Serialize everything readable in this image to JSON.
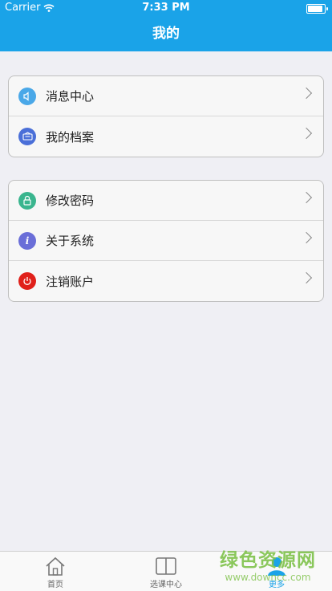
{
  "status_bar": {
    "carrier": "Carrier",
    "time": "7:33 PM"
  },
  "nav": {
    "title": "我的"
  },
  "groups": [
    {
      "items": [
        {
          "label": "消息中心",
          "icon": "speaker-icon",
          "color": "#4aa8e8"
        },
        {
          "label": "我的档案",
          "icon": "profile-card-icon",
          "color": "#4a6fd8"
        }
      ]
    },
    {
      "items": [
        {
          "label": "修改密码",
          "icon": "lock-icon",
          "color": "#3ab58e"
        },
        {
          "label": "关于系统",
          "icon": "info-icon",
          "color": "#6a6ed8"
        },
        {
          "label": "注销账户",
          "icon": "power-icon",
          "color": "#e0201a"
        }
      ]
    }
  ],
  "tabbar": {
    "tabs": [
      {
        "label": "首页",
        "icon": "home-icon",
        "active": false
      },
      {
        "label": "选课中心",
        "icon": "book-icon",
        "active": false
      },
      {
        "label": "更多",
        "icon": "user-icon",
        "active": true
      }
    ]
  },
  "watermark": {
    "line1": "绿色资源网",
    "line2": "www.downcc.com"
  },
  "colors": {
    "accent": "#1aa3e8",
    "background": "#efeff4"
  }
}
